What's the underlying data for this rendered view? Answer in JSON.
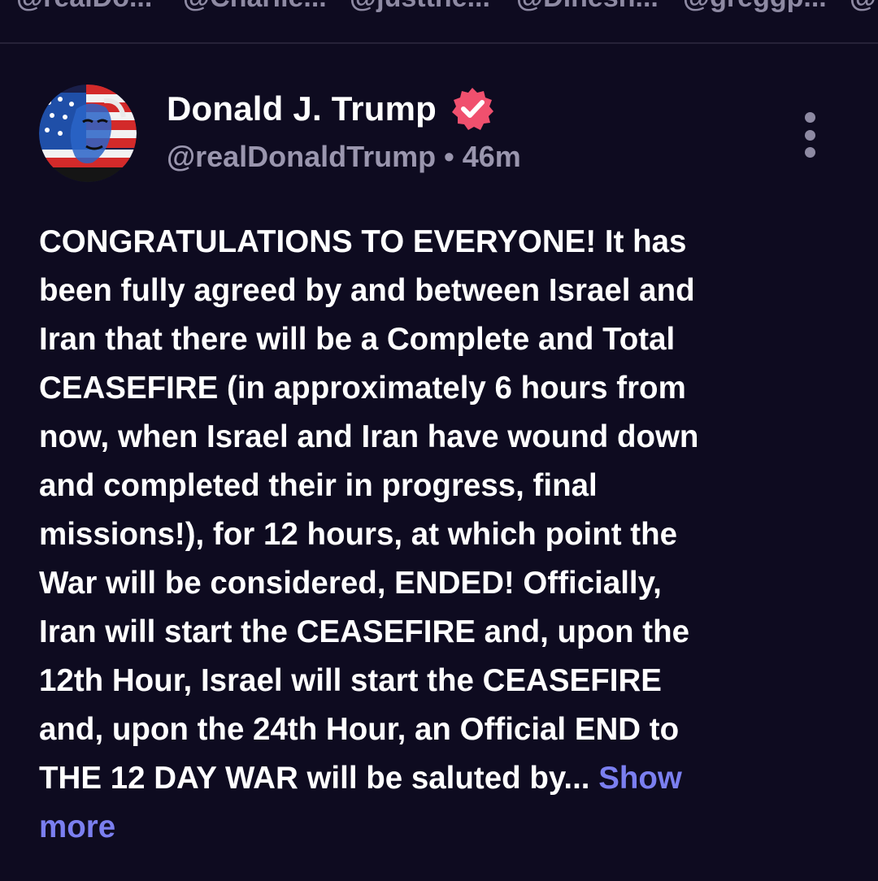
{
  "handle_strip": {
    "handles": [
      "@realDo...",
      "@Charlie...",
      "@justthe...",
      "@Dinesh...",
      "@greggp...",
      "@D"
    ]
  },
  "post": {
    "author": {
      "display_name": "Donald J. Trump",
      "handle": "@realDonaldTrump",
      "verified": true,
      "verified_badge_color": "#f0506e"
    },
    "separator": "•",
    "timestamp": "46m",
    "body_lines": [
      "CONGRATULATIONS TO EVERYONE! It has",
      "been fully agreed by and between Israel and",
      "Iran that there will be a Complete and Total",
      "CEASEFIRE (in approximately 6 hours from",
      "now, when Israel and Iran have wound down",
      "and completed their in progress, final",
      "missions!), for 12 hours, at which point the",
      "War will be considered, ENDED! Officially,",
      "Iran will start the CEASEFIRE and, upon the",
      "12th Hour, Israel will start the CEASEFIRE",
      "and, upon the 24th Hour, an Official END to",
      "THE 12 DAY WAR will be saluted by..."
    ],
    "show_more_part1": "Show",
    "show_more_part2": "more",
    "more_menu_icon": "vertical-ellipsis-icon"
  },
  "colors": {
    "background": "#0e0b20",
    "text": "#ffffff",
    "muted": "#9a96ae",
    "link": "#7b7ff0"
  }
}
